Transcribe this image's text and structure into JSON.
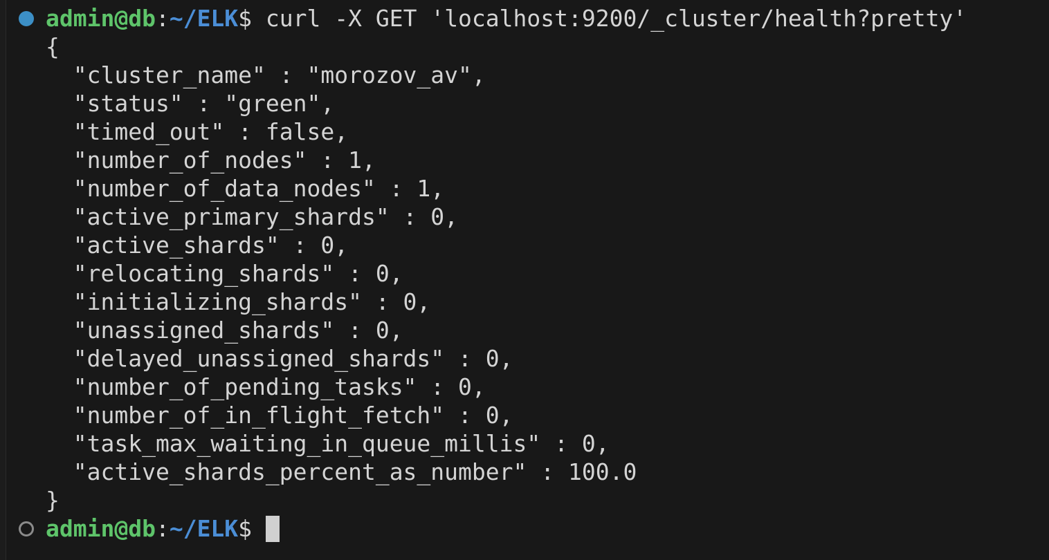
{
  "prompt": {
    "user_host": "admin@db",
    "separator": ":",
    "path": "~/ELK",
    "symbol": "$"
  },
  "command": " curl -X GET 'localhost:9200/_cluster/health?pretty'",
  "output": {
    "open_brace": "{",
    "lines": [
      "  \"cluster_name\" : \"morozov_av\",",
      "  \"status\" : \"green\",",
      "  \"timed_out\" : false,",
      "  \"number_of_nodes\" : 1,",
      "  \"number_of_data_nodes\" : 1,",
      "  \"active_primary_shards\" : 0,",
      "  \"active_shards\" : 0,",
      "  \"relocating_shards\" : 0,",
      "  \"initializing_shards\" : 0,",
      "  \"unassigned_shards\" : 0,",
      "  \"delayed_unassigned_shards\" : 0,",
      "  \"number_of_pending_tasks\" : 0,",
      "  \"number_of_in_flight_fetch\" : 0,",
      "  \"task_max_waiting_in_queue_millis\" : 0,",
      "  \"active_shards_percent_as_number\" : 100.0"
    ],
    "close_brace": "}"
  },
  "second_prompt_input": " ",
  "icons": {
    "first_decoration": "command-success-dot-icon",
    "second_decoration": "command-pending-circle-icon",
    "cursor": "block-cursor"
  },
  "colors": {
    "background": "#181818",
    "user_host": "#5ec46a",
    "path": "#4b8ed6",
    "success_dot": "#3c8fc6",
    "text": "#d4d4d4"
  }
}
